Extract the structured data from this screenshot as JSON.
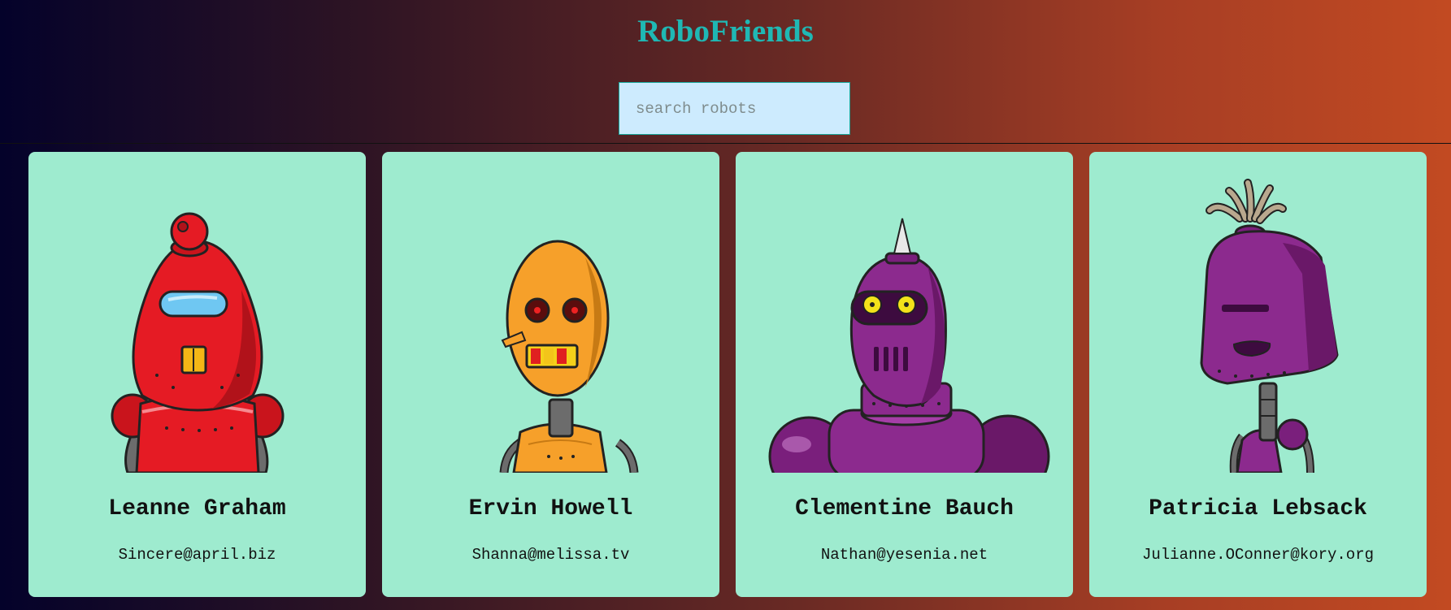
{
  "app": {
    "title": "RoboFriends"
  },
  "search": {
    "placeholder": "search robots",
    "value": ""
  },
  "robots": [
    {
      "name": "Leanne Graham",
      "email": "Sincere@april.biz"
    },
    {
      "name": "Ervin Howell",
      "email": "Shanna@melissa.tv"
    },
    {
      "name": "Clementine Bauch",
      "email": "Nathan@yesenia.net"
    },
    {
      "name": "Patricia Lebsack",
      "email": "Julianne.OConner@kory.org"
    }
  ],
  "colors": {
    "title": "#1fb8b4",
    "card": "#9eebcf",
    "search_bg": "#cdebfe"
  }
}
